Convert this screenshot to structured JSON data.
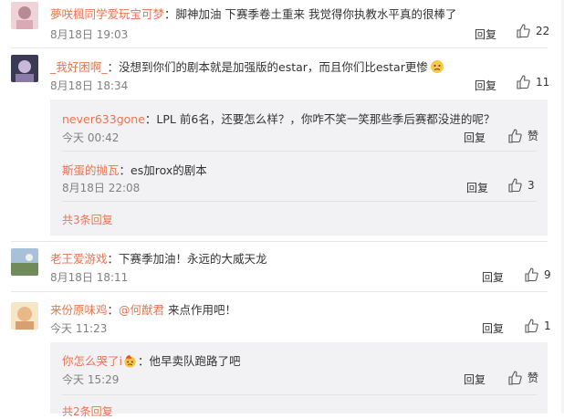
{
  "comments": [
    {
      "user": "夢咲楓同学爱玩宝可梦",
      "sep": "：",
      "text": "脚神加油 下赛季卷土重来 我觉得你执教水平真的很棒了",
      "time": "8月18日 19:03",
      "reply": "回复",
      "likes": "22",
      "avatar_colors": [
        "#e9c9cf",
        "#b88a96"
      ]
    },
    {
      "user": "_我好困啊_",
      "sep": "：",
      "text": "没想到你们的剧本就是加强版的estar，而且你们比estar更惨",
      "time": "8月18日 18:34",
      "reply": "回复",
      "likes": "11",
      "avatar_colors": [
        "#3a3a55",
        "#c9b9d8"
      ]
    },
    {
      "user": "老王爱游戏",
      "sep": "：",
      "text": "下赛季加油！永远的大威天龙",
      "time": "8月18日 18:11",
      "reply": "回复",
      "likes": "9",
      "avatar_colors": [
        "#6f8b5a",
        "#a8c0d8"
      ]
    },
    {
      "user": "来份原味鸡",
      "sep": "：",
      "mention": "@何猷君",
      "text": "来点作用吧！",
      "time": "今天 11:23",
      "reply": "回复",
      "likes": "1",
      "avatar_colors": [
        "#f0d8a8",
        "#d8a070"
      ]
    }
  ],
  "subreplies": [
    {
      "user": "never633gone",
      "sep": "：",
      "text": "LPL 前6名，还要怎么样？，你咋不笑一笑那些季后赛都没进的呢？",
      "time": "今天 00:42",
      "reply": "回复",
      "likes": "赞"
    },
    {
      "user": "斯蛋的抛瓦",
      "sep": "：",
      "text": "es加rox的剧本",
      "time": "8月18日 22:08",
      "reply": "回复",
      "likes": "3"
    },
    {
      "user": "你怎么哭了i",
      "sep": "：",
      "text": "他早卖队跑路了吧",
      "time": "今天 15:29",
      "reply": "回复",
      "likes": "赞"
    }
  ],
  "more_replies": [
    "共3条回复",
    "共2条回复"
  ],
  "icons": {
    "thumb": "thumbs-up-icon",
    "emoji_sad": "sad-face-emoji",
    "emoji_badge": "flame-face-emoji"
  }
}
